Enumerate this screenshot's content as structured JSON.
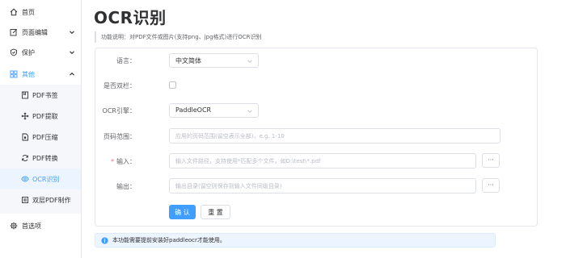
{
  "sidebar": {
    "home": "首页",
    "page_edit": "页面编辑",
    "protect": "保护",
    "other": "其他",
    "sub_items": [
      "PDF书签",
      "PDF提取",
      "PDF压缩",
      "PDF转换",
      "OCR识别",
      "双层PDF制作"
    ],
    "active_item": "OCR识别",
    "preferences": "首选项"
  },
  "main": {
    "title": "OCR识别",
    "description": "功能说明：对PDF文件或图片(支持png、jpg格式)进行OCR识别"
  },
  "form": {
    "language_label": "语言：",
    "language_value": "中文简体",
    "double_column_label": "是否双栏：",
    "double_column_checked": false,
    "engine_label": "OCR引擎：",
    "engine_value": "PaddleOCR",
    "page_range_label": "页码范围：",
    "page_range_placeholder": "应用的页码范围(留空表示全部)，e.g. 1-10",
    "input_required_mark": "*",
    "input_label": "输入：",
    "input_placeholder": "输入文件路径，支持使用*匹配多个文件，如D:\\test\\*.pdf",
    "input_browse": "···",
    "output_label": "输出：",
    "output_placeholder": "输出目录(留空则保存到输入文件同级目录)",
    "output_browse": "···",
    "confirm_label": "确 认",
    "reset_label": "重 置"
  },
  "alert": {
    "text": "本功能需要提前安装好paddleocr才能使用。"
  },
  "colors": {
    "primary": "#409eff",
    "required": "#f56c6c",
    "alert_bg": "#ecf5ff"
  }
}
